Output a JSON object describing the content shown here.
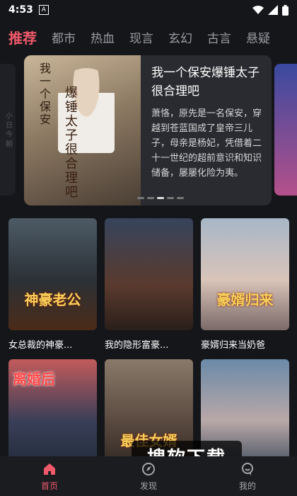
{
  "status": {
    "time": "4:53",
    "notification_icon": "A"
  },
  "tabs": [
    {
      "label": "推荐",
      "active": true
    },
    {
      "label": "都市"
    },
    {
      "label": "热血"
    },
    {
      "label": "现言"
    },
    {
      "label": "玄幻"
    },
    {
      "label": "古言"
    },
    {
      "label": "悬疑"
    }
  ],
  "banner": {
    "title": "我一个保安爆锤太子很合理吧",
    "description": "萧恪，原先是一名保安，穿越到苍蓝国成了皇帝三儿子，母亲是杨妃，凭借着二十一世纪的超前意识和知识储备，屡屡化险为夷。",
    "poster_text_1": "我一个保安",
    "poster_text_2": "爆锤太子很合理吧",
    "peek_left_text": "小 日 今 朝"
  },
  "dramas": [
    {
      "title": "女总裁的神豪...",
      "cover_text": "神豪老公"
    },
    {
      "title": "我的隐形富豪...",
      "cover_text": ""
    },
    {
      "title": "豪婿归来当奶爸",
      "cover_text": "豪婿归来"
    },
    {
      "title": "",
      "cover_text": "离婚后"
    },
    {
      "title": "",
      "cover_text": "最佳女婿"
    },
    {
      "title": "",
      "cover_text": ""
    }
  ],
  "watermark": "搜软下载",
  "bottom_nav": [
    {
      "label": "首页",
      "icon": "home-icon",
      "active": true
    },
    {
      "label": "发现",
      "icon": "discover-icon"
    },
    {
      "label": "我的",
      "icon": "profile-icon"
    }
  ],
  "colors": {
    "accent": "#f05a6b",
    "background": "#15161a"
  }
}
